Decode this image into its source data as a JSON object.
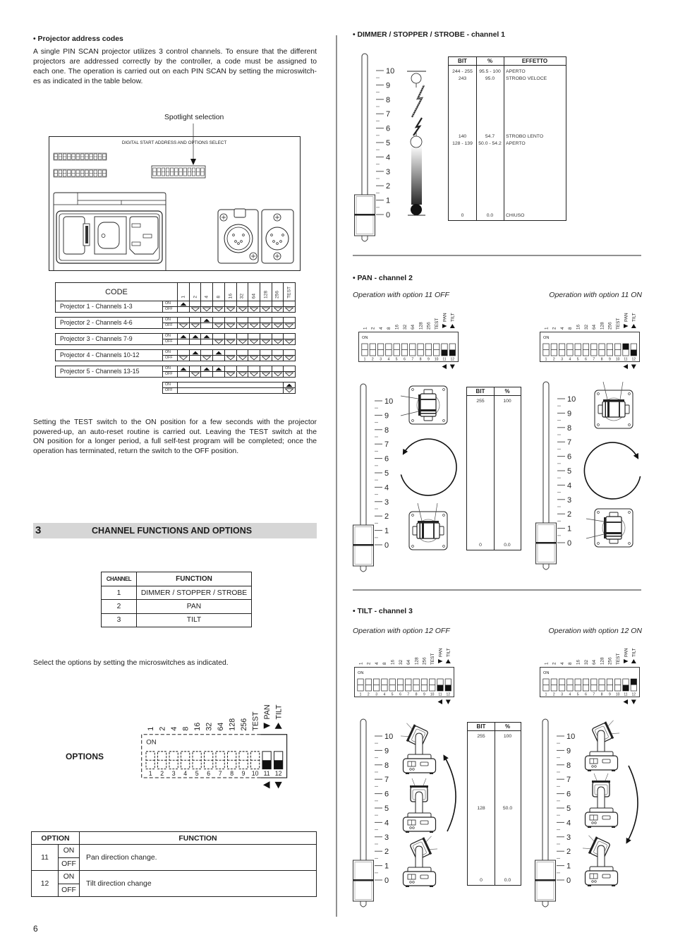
{
  "page_number": "6",
  "left": {
    "address": {
      "heading": "• Projector address codes",
      "paragraph_lines": [
        "A single PIN SCAN projector utilizes 3 control channels. To ensure that the different",
        "projectors are addressed correctly by the controller, a code must be assigned to",
        "each one. The operation is carried out on each PIN SCAN by setting the microswitch-",
        "es as indicated in the table below."
      ],
      "spotlight_label": "Spotlight selection",
      "panel_title": "DIGITAL START ADDRESS AND OPTIONS SELECT",
      "panel_icons": [
        "dip-switch-strip-icon",
        "dip-switch-strip-icon",
        "address-dip-switch-icon",
        "fuse-holder-icon",
        "power-switch-icon",
        "iec-power-socket-icon",
        "xlr-female-connector-icon",
        "xlr-male-connector-icon"
      ]
    },
    "code_table": {
      "header": "CODE",
      "columns": [
        "1",
        "2",
        "4",
        "8",
        "16",
        "32",
        "64",
        "128",
        "256",
        "TEST"
      ],
      "on_label": "ON",
      "off_label": "OFF",
      "rows": [
        {
          "label": "Projector 1 - Channels 1-3",
          "switches": [
            "on",
            "off",
            "off",
            "off",
            "off",
            "off",
            "off",
            "off",
            "off",
            "off"
          ]
        },
        {
          "label": "Projector 2 - Channels 4-6",
          "switches": [
            "off",
            "off",
            "on",
            "off",
            "off",
            "off",
            "off",
            "off",
            "off",
            "off"
          ]
        },
        {
          "label": "Projector 3 - Channels 7-9",
          "switches": [
            "on",
            "on",
            "on",
            "off",
            "off",
            "off",
            "off",
            "off",
            "off",
            "off"
          ]
        },
        {
          "label": "Projector 4 - Channels 10-12",
          "switches": [
            "off",
            "on",
            "off",
            "on",
            "off",
            "off",
            "off",
            "off",
            "off",
            "off"
          ]
        },
        {
          "label": "Projector 5 - Channels 13-15",
          "switches": [
            "on",
            "off",
            "on",
            "on",
            "off",
            "off",
            "off",
            "off",
            "off",
            "off"
          ]
        }
      ],
      "test_row": {
        "test_switch": "on-or-off"
      }
    },
    "test_paragraph_lines": [
      "Setting the TEST switch to the ON position for a few seconds with the projector",
      "powered-up, an auto-reset routine is carried out. Leaving the TEST switch at the",
      "ON position for a longer period, a full self-test program will be completed; once the",
      "operation has terminated, return the switch to the OFF position."
    ],
    "section": {
      "number": "3",
      "title": "CHANNEL FUNCTIONS AND OPTIONS"
    },
    "channel_table": {
      "headers": [
        "CHANNEL",
        "FUNCTION"
      ],
      "rows": [
        [
          "1",
          "DIMMER / STOPPER / STROBE"
        ],
        [
          "2",
          "PAN"
        ],
        [
          "3",
          "TILT"
        ]
      ]
    },
    "options_intro": "Select the options by setting the microswitches as indicated.",
    "options_label": "OPTIONS",
    "options_table": {
      "headers": [
        "OPTION",
        "FUNCTION"
      ],
      "rows": [
        {
          "option": "11",
          "on": "ON",
          "off": "OFF",
          "function": "Pan direction change."
        },
        {
          "option": "12",
          "on": "ON",
          "off": "OFF",
          "function": "Tilt direction change"
        }
      ]
    }
  },
  "dip_switch": {
    "on_label": "ON",
    "labels": [
      "1",
      "2",
      "4",
      "8",
      "16",
      "32",
      "64",
      "128",
      "256",
      "TEST",
      "PAN",
      "TILT"
    ],
    "numbers": [
      "1",
      "2",
      "3",
      "4",
      "5",
      "6",
      "7",
      "8",
      "9",
      "10",
      "11",
      "12"
    ]
  },
  "dip_diagrams": {
    "options": [
      "inactive",
      "inactive",
      "inactive",
      "inactive",
      "inactive",
      "inactive",
      "inactive",
      "inactive",
      "inactive",
      "inactive",
      "off",
      "off"
    ],
    "pan_off": [
      "neutral",
      "neutral",
      "neutral",
      "neutral",
      "neutral",
      "neutral",
      "neutral",
      "neutral",
      "neutral",
      "neutral",
      "off",
      "off"
    ],
    "pan_on": [
      "neutral",
      "neutral",
      "neutral",
      "neutral",
      "neutral",
      "neutral",
      "neutral",
      "neutral",
      "neutral",
      "neutral",
      "on",
      "off"
    ],
    "tilt_off": [
      "neutral",
      "neutral",
      "neutral",
      "neutral",
      "neutral",
      "neutral",
      "neutral",
      "neutral",
      "neutral",
      "neutral",
      "off",
      "off"
    ],
    "tilt_on": [
      "neutral",
      "neutral",
      "neutral",
      "neutral",
      "neutral",
      "neutral",
      "neutral",
      "neutral",
      "neutral",
      "neutral",
      "off",
      "on"
    ]
  },
  "right": {
    "fader_scale": [
      "10",
      "9",
      "8",
      "7",
      "6",
      "5",
      "4",
      "3",
      "2",
      "1",
      "0"
    ],
    "dimmer": {
      "heading": "• DIMMER / STOPPER / STROBE - channel 1",
      "table": {
        "headers": [
          "BIT",
          "%",
          "EFFETTO"
        ],
        "rows": [
          {
            "bit": "244 - 255",
            "percent": "95.5 - 100",
            "effect": "APERTO",
            "position_percent": 100
          },
          {
            "bit": "243",
            "percent": "95.0",
            "effect": "STROBO VELOCE",
            "position_percent": 95
          },
          {
            "bit": "140",
            "percent": "54.7",
            "effect": "STROBO LENTO",
            "position_percent": 54.7
          },
          {
            "bit": "128 - 139",
            "percent": "50.0 - 54.2",
            "effect": "APERTO",
            "position_percent": 50
          },
          {
            "bit": "0",
            "percent": "0.0",
            "effect": "CHIUSO",
            "position_percent": 0
          }
        ]
      },
      "illustration_icons": [
        "open-shutter-icon",
        "strobe-fast-lightning-icon",
        "strobe-slow-lightning-icon",
        "open-shutter-icon",
        "dimmer-gradient",
        "closed-shutter-icon"
      ]
    },
    "pan": {
      "heading": "• PAN - channel 2",
      "option_off_label": "Operation with option 11 OFF",
      "option_on_label": "Operation with option 11 ON",
      "rotation_option_off": "counterclockwise",
      "rotation_option_on": "clockwise",
      "table": {
        "headers": [
          "BIT",
          "%"
        ],
        "rows": [
          {
            "bit": "255",
            "percent": "100",
            "position_percent": 100
          },
          {
            "bit": "0",
            "percent": "0.0",
            "position_percent": 0
          }
        ]
      }
    },
    "tilt": {
      "heading": "• TILT - channel 3",
      "option_off_label": "Operation with option 12 OFF",
      "option_on_label": "Operation with option 12 ON",
      "movement_option_off": "upward",
      "movement_option_on": "downward",
      "table": {
        "headers": [
          "BIT",
          "%"
        ],
        "rows": [
          {
            "bit": "255",
            "percent": "100",
            "position_percent": 100
          },
          {
            "bit": "128",
            "percent": "50.0",
            "position_percent": 50
          },
          {
            "bit": "0",
            "percent": "0.0",
            "position_percent": 0
          }
        ]
      }
    }
  }
}
